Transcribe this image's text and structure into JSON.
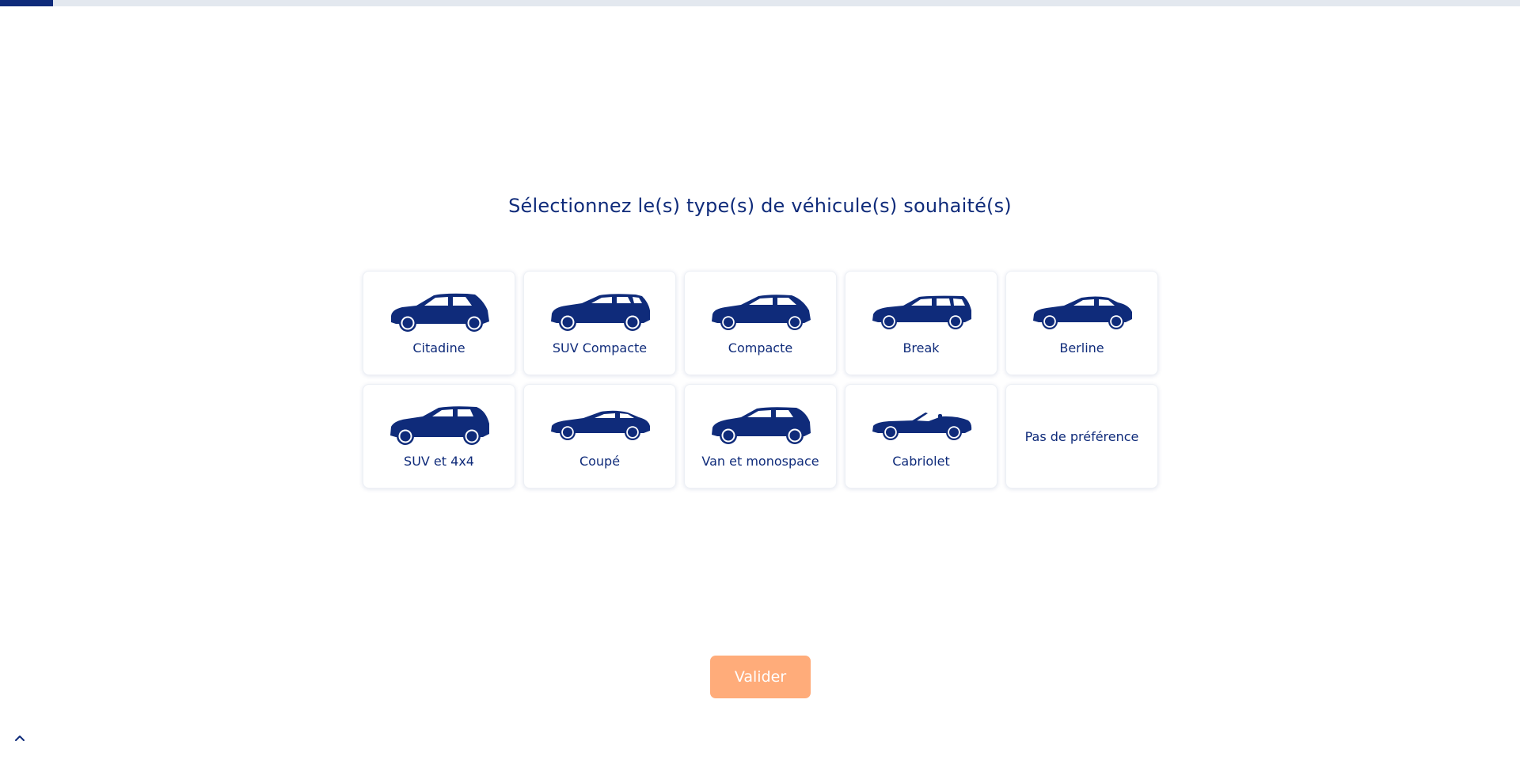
{
  "progress": {
    "fraction": 0.035,
    "fill_color": "#0f2b7a",
    "track_color": "#e3e8ef"
  },
  "page": {
    "title": "Sélectionnez le(s) type(s) de véhicule(s) souhaité(s)"
  },
  "vehicle_types": [
    {
      "label": "Citadine",
      "icon": "hatchback-car-icon"
    },
    {
      "label": "SUV Compacte",
      "icon": "compact-suv-icon"
    },
    {
      "label": "Compacte",
      "icon": "compact-car-icon"
    },
    {
      "label": "Break",
      "icon": "station-wagon-icon"
    },
    {
      "label": "Berline",
      "icon": "sedan-car-icon"
    },
    {
      "label": "SUV et 4x4",
      "icon": "suv-4x4-icon"
    },
    {
      "label": "Coupé",
      "icon": "coupe-car-icon"
    },
    {
      "label": "Van et monospace",
      "icon": "minivan-icon"
    },
    {
      "label": "Cabriolet",
      "icon": "convertible-car-icon"
    },
    {
      "label": "Pas de préférence",
      "icon": ""
    }
  ],
  "actions": {
    "validate_label": "Valider",
    "validate_color": "#ffac7a"
  },
  "scroll_top": {
    "icon": "chevron-up-icon"
  },
  "colors": {
    "brand": "#0f2b7a"
  }
}
